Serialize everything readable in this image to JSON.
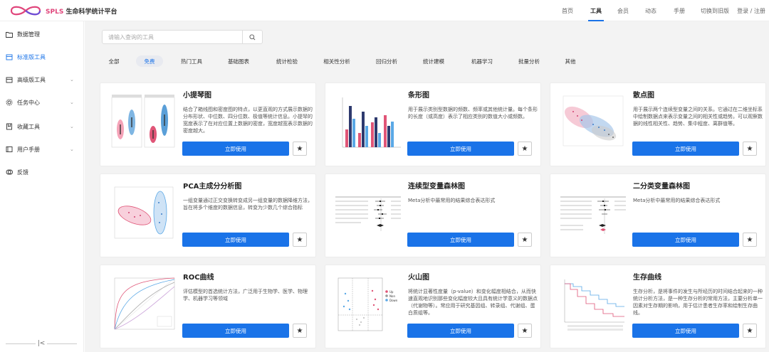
{
  "brand": {
    "en": "SPLS",
    "cn": "生命科学统计平台"
  },
  "nav": [
    {
      "label": "首页"
    },
    {
      "label": "工具"
    },
    {
      "label": "会员"
    },
    {
      "label": "动态"
    },
    {
      "label": "手册"
    },
    {
      "label": "切换到旧版"
    },
    {
      "label": "登录 / 注册"
    }
  ],
  "sidebar": {
    "items": [
      {
        "label": "数据管理",
        "icon": "folder-icon"
      },
      {
        "label": "标准版工具",
        "icon": "box-icon"
      },
      {
        "label": "高级版工具",
        "icon": "box-icon"
      },
      {
        "label": "任务中心",
        "icon": "gear-icon"
      },
      {
        "label": "收藏工具",
        "icon": "bookmark-icon"
      },
      {
        "label": "用户手册",
        "icon": "book-icon"
      },
      {
        "label": "反馈",
        "icon": "feedback-icon"
      }
    ],
    "collapse_glyph": "|<"
  },
  "search": {
    "placeholder": "请输入查询的工具"
  },
  "categories": [
    "全部",
    "免费",
    "热门工具",
    "基础图表",
    "统计检验",
    "相关性分析",
    "回归分析",
    "统计建模",
    "机器学习",
    "批量分析",
    "其他"
  ],
  "cards": [
    {
      "title": "小提琴图",
      "desc": "结合了箱线图和密度图的特点，以更直观的方式展示数据的分布形状、中位数、四分位数、极值等统计信息。小提琴的宽度表示了在对应位置上数据的密度，宽度越宽表示数据的密度越大。",
      "button": "立即使用"
    },
    {
      "title": "条形图",
      "desc": "用于展示类别型数据的频数、频率或其他统计量。每个条形的长度（或高度）表示了相应类别的数值大小或频数。",
      "button": "立即使用"
    },
    {
      "title": "散点图",
      "desc": "用于展示两个连续型变量之间的关系。它通过在二维坐标系中绘制数据点来表示变量之间的相关性或趋势。可以观察数据的线性相关性、趋势、集中程度、离群值等。",
      "button": "立即使用"
    },
    {
      "title": "PCA主成分分析图",
      "desc": "一组变量通过正交变换转变成另一组变量的数据降维方法，旨在将多个维度的数据信息，转变为少数几个综合指标",
      "button": "立即使用"
    },
    {
      "title": "连续型变量森林图",
      "desc": "Meta分析中最常用的结果综合表达形式",
      "button": "立即使用"
    },
    {
      "title": "二分类变量森林图",
      "desc": "Meta分析中最常用的结果综合表达形式",
      "button": "立即使用"
    },
    {
      "title": "ROC曲线",
      "desc": "评估模型的首选统计方法，广泛用于生物学、医学、物理学、机器学习等领域",
      "button": "立即使用"
    },
    {
      "title": "火山图",
      "desc": "将统计显著性度量（p-value）和变化幅度相结合，从而快速直观地识别那些变化幅度较大且具有统计学意义的数据点（代谢物等）。常应用于研究基因组、转录组、代谢组、蛋白质组等。",
      "button": "立即使用"
    },
    {
      "title": "生存曲线",
      "desc": "生存分析，是将事件的发生与所经历的时间结合起来的一种统计分析方法，是一种生存分析的常用方法，主要分析单一因素对生存期的影响，用于估计患者生存率和绘制生存曲线。",
      "button": "立即使用"
    }
  ],
  "thumb_text": {
    "volcano_legend": [
      "Up",
      "Non",
      "Down"
    ]
  },
  "colors": {
    "accent": "#1a73e8",
    "brand_pink": "#e0457b"
  }
}
